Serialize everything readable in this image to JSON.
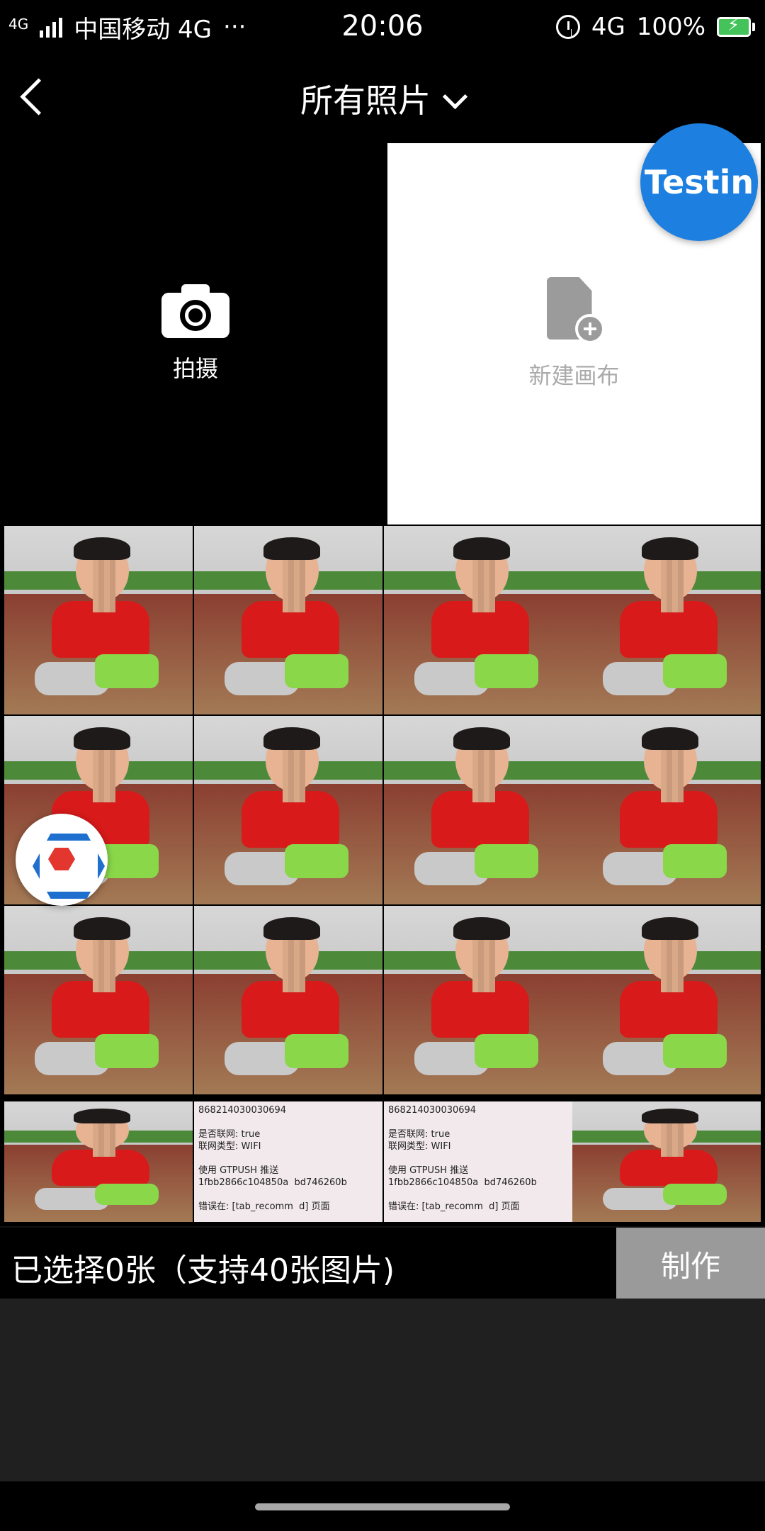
{
  "status_bar": {
    "network_left": "4G",
    "carrier": "中国移动 4G",
    "more": "···",
    "time": "20:06",
    "network_right": "4G",
    "battery_percent": "100%"
  },
  "header": {
    "title": "所有照片"
  },
  "actions": {
    "camera_label": "拍摄",
    "new_canvas_label": "新建画布"
  },
  "floating": {
    "testin_label": "Testin"
  },
  "screenshots": [
    "868214030030694\n\n是否联网: true\n联网类型: WIFI\n\n使用 GTPUSH 推送\n1fbb2866c104850a  bd746260b\n\n错误在: [tab_recomm  d] 页面",
    "868214030030694\n\n是否联网: true\n联网类型: WIFI\n\n使用 GTPUSH 推送\n1fbb2866c104850a  bd746260b\n\n错误在: [tab_recomm  d] 页面"
  ],
  "bottom_bar": {
    "selected_text": "已选择0张（支持40张图片)",
    "make_button": "制作"
  }
}
